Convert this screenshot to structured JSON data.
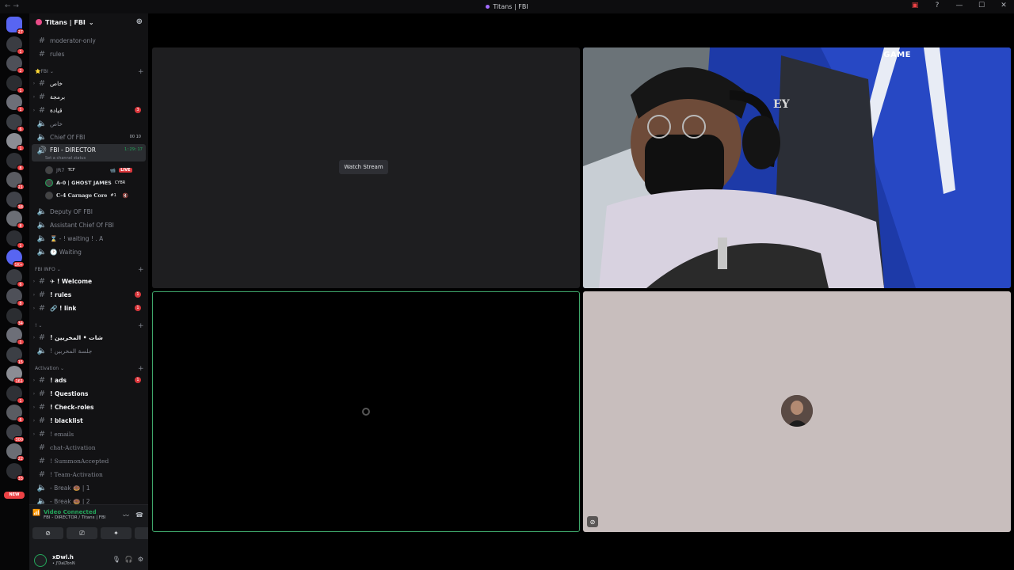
{
  "window": {
    "title": "Titans | FBI"
  },
  "server_rail": {
    "badges": [
      "27",
      "1",
      "2",
      "1",
      "1",
      "6",
      "1",
      "8",
      "21",
      "38",
      "8",
      "1",
      "1K+",
      "6",
      "8",
      "34",
      "1",
      "15",
      "161",
      "1",
      "6",
      "300",
      "22",
      "33"
    ],
    "new_label": "NEW"
  },
  "guild": {
    "name": "Titans | FBI"
  },
  "channels": {
    "top": [
      "moderator-only",
      "rules"
    ],
    "cat_fbi": "⭐FBI",
    "fbi_items": [
      "خاص",
      "برمجة",
      "قيادة",
      "خاص"
    ],
    "fbi_unread": "3",
    "chief": "Chief Of FBI",
    "chief_meta": "00  10",
    "director": "FBI - DIRECTOR",
    "director_timer": "1:29:17",
    "director_status": "Set a channel status",
    "voice_users": [
      {
        "name": "JR7",
        "tag": "TCF",
        "live": "LIVE"
      },
      {
        "name": "A-0 | GHOST JAMES",
        "tag": "CYBR"
      },
      {
        "name": "C-4 Carnage Core",
        "tag": "#1"
      }
    ],
    "more_voice": [
      "Deputy OF FBI",
      "Assistant Chief Of FBI",
      "⌛ - ! waiting ! . A",
      "🕐 Waiting"
    ],
    "cat_info": "FBI INFO",
    "info_items": [
      "✈ ! Welcome",
      "! rules",
      "🔗 ! link"
    ],
    "info_unread": [
      "1",
      "1"
    ],
    "cat_misc": "!",
    "misc_items": [
      "! شات • المخربين",
      "! جلسة المخربين"
    ],
    "cat_activation": "Activation",
    "activation_items": [
      "! ads",
      "! Questions",
      "! Check-roles",
      "! blacklist",
      "! emails",
      "chat-Activation",
      "! SummonAccepted",
      "! Team-Activation",
      "- Break 🍩 | 1",
      "- Break 🍩 | 2"
    ],
    "activation_unread": "1"
  },
  "voice_panel": {
    "status": "Video Connected",
    "location": "FBI - DIRECTOR / Titans | FBI"
  },
  "user": {
    "name": "xDwl.h",
    "status": "• J'DaLTonN"
  },
  "stage": {
    "watch_label": "Watch Stream",
    "game_logo": "GAME",
    "game_mark": "EY"
  },
  "colors": {
    "accent_green": "#23a55a",
    "unread_red": "#da373c",
    "stream_blue": "#152a8a"
  }
}
